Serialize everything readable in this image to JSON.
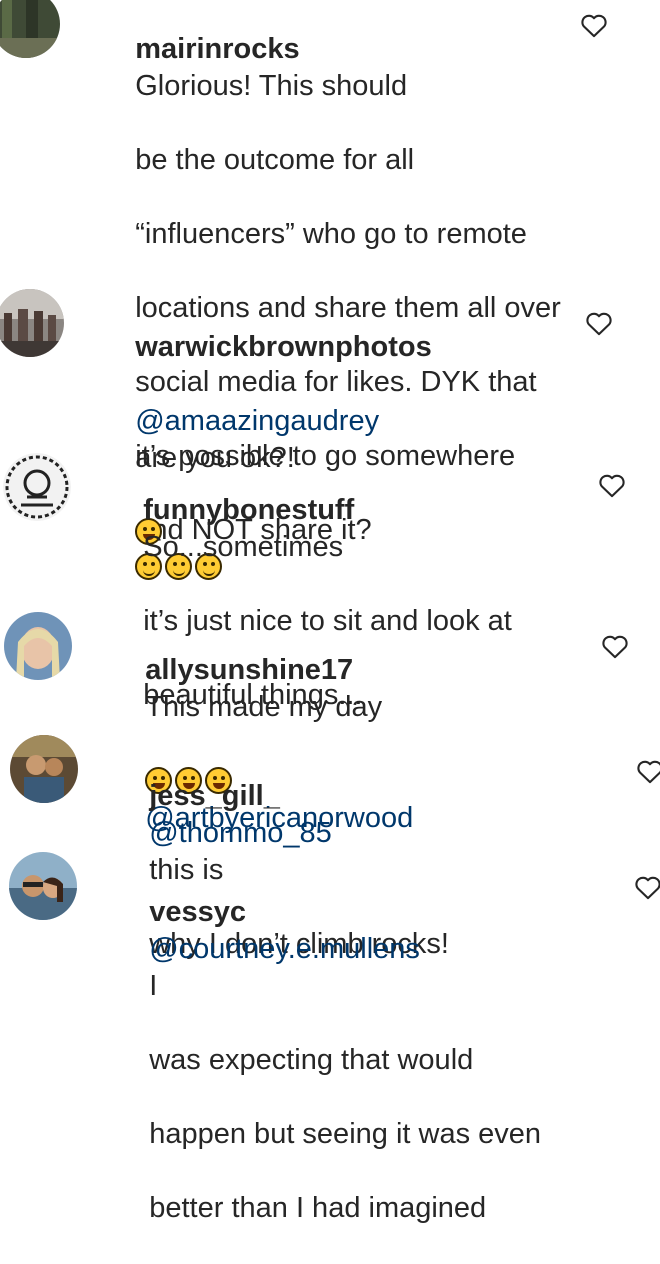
{
  "comments": [
    {
      "username": "mairinrocks",
      "text": "Glorious! This should be the outcome for all “influencers” who go to remote locations and share them all over social media for likes. DYK that it’s possible to go somewhere and NOT share it?",
      "lines": [
        "Glorious! This should",
        "be the outcome for all",
        "“influencers” who go to remote",
        "locations and share them all over",
        "social media for likes. DYK that",
        "it’s possible to go somewhere",
        "and NOT share it?"
      ],
      "emoji": [
        "monocle-face",
        "thinking-face",
        "hushed-face"
      ]
    },
    {
      "username": "warwickbrownphotos",
      "mention": "@amaazingaudrey",
      "text": "are you ok?!",
      "emoji": [
        "tears-of-joy-face"
      ]
    },
    {
      "username": "funnybonestuff",
      "text": "So...sometimes it’s just nice to sit and look at beautiful things...",
      "lines": [
        "So...sometimes",
        "it’s just nice to sit and look at",
        "beautiful things..."
      ]
    },
    {
      "username": "allysunshine17",
      "text": "This made my day",
      "emoji": [
        "tears-of-joy-face",
        "tears-of-joy-face",
        "tears-of-joy-face"
      ],
      "mention": "@artbyericanorwood"
    },
    {
      "username": "jess_gill_",
      "mention": "@thommo_85",
      "text": "this is",
      "line2": "why I don’t climb rocks!"
    },
    {
      "username": "vessyc",
      "mention": "@courtney.e.mullens",
      "text": "I",
      "lines": [
        "was expecting that would",
        "happen but seeing it was even",
        "better than I had imagined"
      ]
    }
  ],
  "icons": {
    "like": "heart-outline-icon"
  },
  "colors": {
    "text": "#262626",
    "mention": "#00376b",
    "icon": "#262626"
  }
}
